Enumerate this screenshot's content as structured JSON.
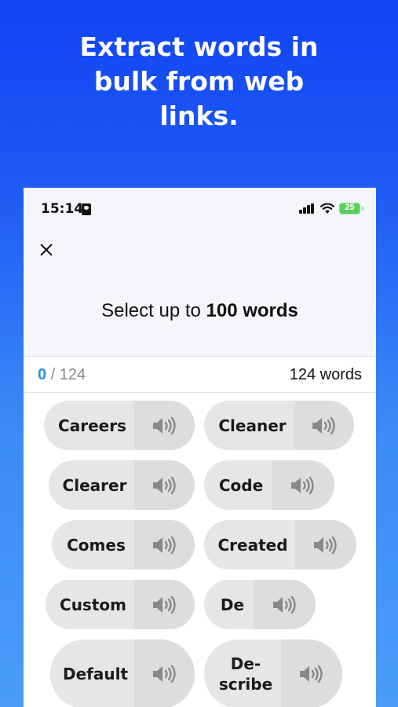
{
  "headline": {
    "line1": "Extract words in",
    "line2": "bulk from web",
    "line3": "links."
  },
  "status_bar": {
    "time": "15:14",
    "battery": "25"
  },
  "modal": {
    "title_prefix": "Select up to ",
    "title_bold": "100 words"
  },
  "counter": {
    "selected": "0",
    "total_fraction": " / 124",
    "total_words": "124 words"
  },
  "words": [
    {
      "label": "Careers"
    },
    {
      "label": "Cleaner"
    },
    {
      "label": "Clearer"
    },
    {
      "label": "Code"
    },
    {
      "label": "Comes"
    },
    {
      "label": "Created"
    },
    {
      "label": "Custom"
    },
    {
      "label": "De"
    },
    {
      "label": "Default"
    },
    {
      "label": "De-\nscribe"
    }
  ],
  "colors": {
    "accent": "#2f8de4",
    "chip": "#e6e6e6",
    "speaker": "#dddddd",
    "battery": "#5ccf5a"
  },
  "icons": {
    "close": "close-icon",
    "speaker": "speaker-icon"
  }
}
